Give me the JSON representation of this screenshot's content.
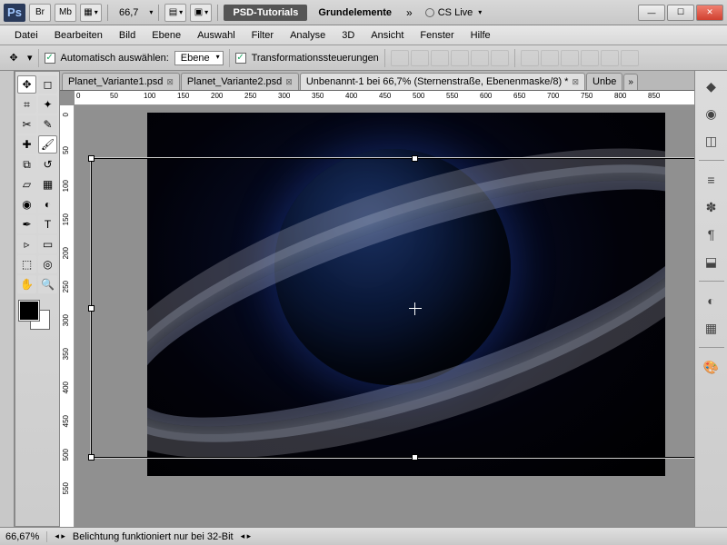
{
  "titlebar": {
    "app_abbrev": "Ps",
    "br_label": "Br",
    "mb_label": "Mb",
    "zoom": "66,7",
    "psd_tutorials": "PSD-Tutorials",
    "grundelemente": "Grundelemente",
    "cslive": "CS Live"
  },
  "menu": {
    "items": [
      "Datei",
      "Bearbeiten",
      "Bild",
      "Ebene",
      "Auswahl",
      "Filter",
      "Analyse",
      "3D",
      "Ansicht",
      "Fenster",
      "Hilfe"
    ]
  },
  "options": {
    "auto_select_label": "Automatisch auswählen:",
    "auto_select_value": "Ebene",
    "transform_controls_label": "Transformationssteuerungen"
  },
  "tabs": {
    "items": [
      {
        "label": "Planet_Variante1.psd",
        "active": false
      },
      {
        "label": "Planet_Variante2.psd",
        "active": false
      },
      {
        "label": "Unbenannt-1 bei 66,7% (Sternenstraße, Ebenenmaske/8) *",
        "active": true
      },
      {
        "label": "Unbe",
        "active": false
      }
    ]
  },
  "ruler_h": [
    "0",
    "50",
    "100",
    "150",
    "200",
    "250",
    "300",
    "350",
    "400",
    "450",
    "500",
    "550",
    "600",
    "650",
    "700",
    "750",
    "800",
    "850"
  ],
  "ruler_v": [
    "0",
    "50",
    "100",
    "150",
    "200",
    "250",
    "300",
    "350",
    "400",
    "450",
    "500",
    "550"
  ],
  "status": {
    "zoom": "66,67%",
    "message": "Belichtung funktioniert nur bei 32-Bit"
  },
  "tools": {
    "left": [
      [
        "move",
        "marquee"
      ],
      [
        "lasso",
        "wand"
      ],
      [
        "crop",
        "eyedrop"
      ],
      [
        "heal",
        "brush"
      ],
      [
        "stamp",
        "history"
      ],
      [
        "eraser",
        "gradient"
      ],
      [
        "blur",
        "dodge"
      ],
      [
        "pen",
        "type"
      ],
      [
        "path",
        "shape"
      ],
      [
        "3d",
        "3dcam"
      ],
      [
        "hand",
        "zoom"
      ]
    ]
  },
  "right_icons": [
    "layers",
    "channels",
    "paths",
    "adjust",
    "char",
    "para",
    "styles",
    "stamp",
    "",
    "bw",
    "swatch",
    "",
    "color"
  ]
}
